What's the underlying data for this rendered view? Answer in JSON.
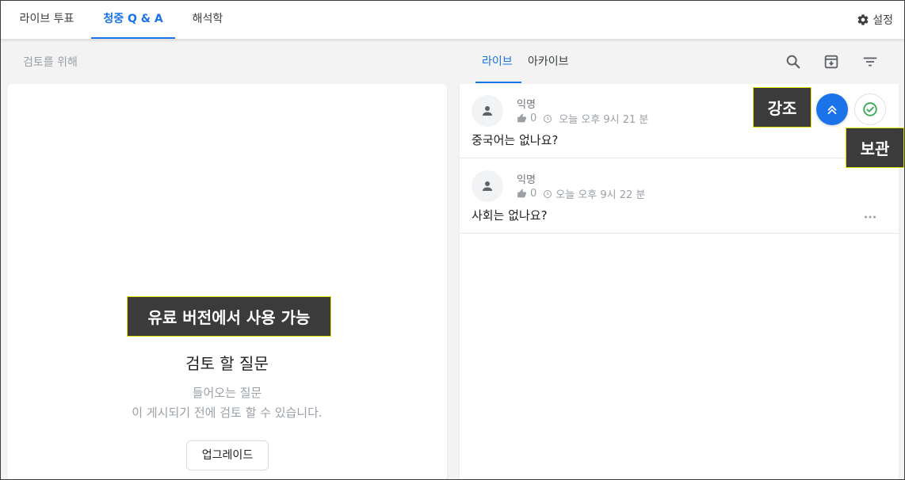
{
  "nav": {
    "tabs": [
      {
        "label": "라이브 투표"
      },
      {
        "label": "청중 Q & A"
      },
      {
        "label": "해석학"
      }
    ],
    "settings_label": "설정"
  },
  "subbar": {
    "review_label": "검토를 위해",
    "tabs": [
      {
        "label": "라이브"
      },
      {
        "label": "아카이브"
      }
    ]
  },
  "review_panel": {
    "title": "검토 할 질문",
    "desc_line1": "들어오는 질문",
    "desc_line2": "이 게시되기 전에 검토 할 수 있습니다.",
    "upgrade_label": "업그레이드"
  },
  "questions": [
    {
      "author": "익명",
      "likes": "0",
      "time": "오늘 오후 9시 21 분",
      "text": "중국어는 없나요?"
    },
    {
      "author": "익명",
      "likes": "0",
      "time": "오늘 오후 9시 22 분",
      "text": "사회는 없나요?"
    }
  ],
  "callouts": {
    "paid": "유료 버전에서 사용 가능",
    "highlight": "강조",
    "archive": "보관"
  },
  "colors": {
    "accent": "#1a73e8",
    "callout_bg": "#3b3b3b",
    "callout_border": "#e5e500"
  }
}
